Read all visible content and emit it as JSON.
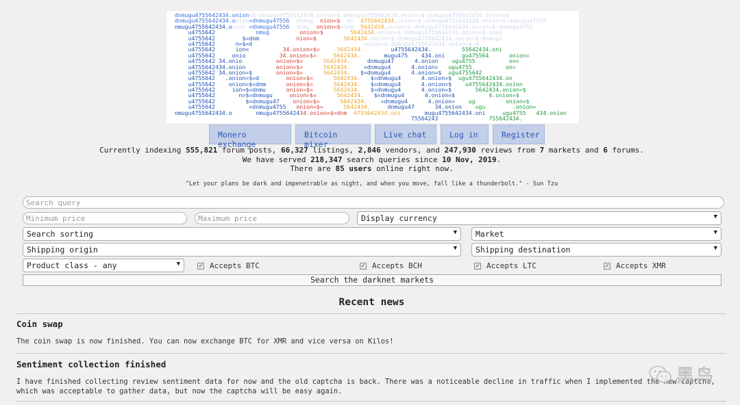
{
  "logo_rows": [
    [
      [
        "c-f",
        "  "
      ],
      [
        "c-b",
        "dnmugu4755642434.onion"
      ],
      [
        "c-f",
        "=$-dnmugu4755642434.onion=$-dnmugu4755642434.onion=$-dnmugu4755642434.onion=$"
      ]
    ],
    [
      [
        "c-b",
        "  dnmugu4755642434.o"
      ],
      [
        "c-f",
        "nion"
      ],
      [
        "c-b",
        "=dnmugu47556"
      ],
      [
        "c-f",
        "  dnmug"
      ],
      [
        "c-r",
        "  nion=$"
      ],
      [
        "c-f",
        "  dn  "
      ],
      [
        "c-o",
        "4755642434."
      ],
      [
        "c-f",
        "onion=$-dnmugu4755642434.onion=$-dnmugu47556"
      ]
    ],
    [
      [
        "c-n",
        "  nmugu4755642434.o"
      ],
      [
        "c-f",
        "nion "
      ],
      [
        "c-b",
        "=dnmugu47556"
      ],
      [
        "c-f",
        "  dnmu"
      ],
      [
        "c-r",
        "  onion=$-"
      ],
      [
        "c-f",
        "dnm  "
      ],
      [
        "c-o",
        "5642434."
      ],
      [
        "c-f",
        "onion=$-dnmugu4755642434.onion=$-dnmugu4755"
      ]
    ],
    [
      [
        "c-f",
        "      "
      ],
      [
        "c-n",
        "u4755642"
      ],
      [
        "c-f",
        "            "
      ],
      [
        "c-b",
        "nmug"
      ],
      [
        "c-f",
        "         "
      ],
      [
        "c-r",
        "onion=$"
      ],
      [
        "c-f",
        "        "
      ],
      [
        "c-o",
        "5642434."
      ],
      [
        "c-f",
        "onion=$-dnmugu4755642434.onion=$-dnmu"
      ]
    ],
    [
      [
        "c-f",
        "      "
      ],
      [
        "c-n",
        "u4755642"
      ],
      [
        "c-f",
        "        "
      ],
      [
        "c-n",
        "$=dnm"
      ],
      [
        "c-f",
        "           "
      ],
      [
        "c-r",
        "nion=$"
      ],
      [
        "c-f",
        "        "
      ],
      [
        "c-o",
        "5642434."
      ],
      [
        "c-f",
        "onion=$-dnmugu4755642434.onion=$-dnmugu"
      ]
    ],
    [
      [
        "c-f",
        "      "
      ],
      [
        "c-n",
        "u4755642"
      ],
      [
        "c-f",
        "      "
      ],
      [
        "c-n",
        "n=$=d"
      ],
      [
        "c-f",
        "                                 onion=$-dnmugu4755642434.onion=$-d"
      ]
    ],
    [
      [
        "c-f",
        "      "
      ],
      [
        "c-n",
        "u4755642"
      ],
      [
        "c-f",
        "      "
      ],
      [
        "c-n",
        "ion="
      ],
      [
        "c-f",
        "          "
      ],
      [
        "c-r",
        "34.onion=$="
      ],
      [
        "c-f",
        "     "
      ],
      [
        "c-o",
        "5642434."
      ],
      [
        "c-f",
        "        "
      ],
      [
        "c-n",
        "u4755642434."
      ],
      [
        "c-f",
        "         "
      ],
      [
        "c-g",
        "55642434.oni"
      ]
    ],
    [
      [
        "c-f",
        "      "
      ],
      [
        "c-n",
        "u4755642"
      ],
      [
        "c-f",
        "     "
      ],
      [
        "c-n",
        "onio"
      ],
      [
        "c-f",
        "          "
      ],
      [
        "c-r",
        "34.onion=$="
      ],
      [
        "c-f",
        "     "
      ],
      [
        "c-o",
        "5642434."
      ],
      [
        "c-f",
        "       "
      ],
      [
        "c-n",
        "mugu475"
      ],
      [
        "c-f",
        "    "
      ],
      [
        "c-n",
        "434.oni"
      ],
      [
        "c-f",
        "     "
      ],
      [
        "c-g",
        "gu475564"
      ],
      [
        "c-f",
        "      "
      ],
      [
        "c-g",
        "onion="
      ]
    ],
    [
      [
        "c-f",
        "      "
      ],
      [
        "c-n",
        "u4755642 34.onio"
      ],
      [
        "c-f",
        "          "
      ],
      [
        "c-r",
        "onion=$="
      ],
      [
        "c-f",
        "      "
      ],
      [
        "c-o",
        "5642434."
      ],
      [
        "c-f",
        "     "
      ],
      [
        "c-n",
        "dnmugu47"
      ],
      [
        "c-f",
        "      "
      ],
      [
        "c-n",
        "4.onion"
      ],
      [
        "c-f",
        "    "
      ],
      [
        "c-g",
        "ugu4755"
      ],
      [
        "c-f",
        "          "
      ],
      [
        "c-g",
        "on="
      ]
    ],
    [
      [
        "c-f",
        "      "
      ],
      [
        "c-n",
        "u4755642434.onion"
      ],
      [
        "c-f",
        "         "
      ],
      [
        "c-r",
        "onion=$="
      ],
      [
        "c-f",
        "      "
      ],
      [
        "c-o",
        "5642434."
      ],
      [
        "c-f",
        "    "
      ],
      [
        "c-n",
        "=dnmugu4"
      ],
      [
        "c-f",
        "      "
      ],
      [
        "c-n",
        "4.onion="
      ],
      [
        "c-f",
        "   "
      ],
      [
        "c-g",
        "ugu4755"
      ],
      [
        "c-f",
        "          "
      ],
      [
        "c-g",
        "on="
      ]
    ],
    [
      [
        "c-f",
        "      "
      ],
      [
        "c-n",
        "u4755642 34.onion=$"
      ],
      [
        "c-f",
        "       "
      ],
      [
        "c-r",
        "onion=$="
      ],
      [
        "c-f",
        "      "
      ],
      [
        "c-o",
        "5642434."
      ],
      [
        "c-f",
        "   "
      ],
      [
        "c-n",
        "$=dnmugu4"
      ],
      [
        "c-f",
        "      "
      ],
      [
        "c-n",
        "4.onion=$"
      ],
      [
        "c-f",
        "  "
      ],
      [
        "c-g",
        "ugu4755642"
      ]
    ],
    [
      [
        "c-f",
        "      "
      ],
      [
        "c-n",
        "u4755642"
      ],
      [
        "c-f",
        "   "
      ],
      [
        "c-n",
        ".onion=$=d"
      ],
      [
        "c-f",
        "        "
      ],
      [
        "c-r",
        "onion=$="
      ],
      [
        "c-f",
        "      "
      ],
      [
        "c-o",
        "5642434."
      ],
      [
        "c-f",
        "   "
      ],
      [
        "c-n",
        "$=dnmugu4"
      ],
      [
        "c-f",
        "      "
      ],
      [
        "c-n",
        "4.onion=$"
      ],
      [
        "c-f",
        "  "
      ],
      [
        "c-g",
        "ugu4755642434.on"
      ]
    ],
    [
      [
        "c-f",
        "      "
      ],
      [
        "c-n",
        "u4755642"
      ],
      [
        "c-f",
        "    "
      ],
      [
        "c-n",
        "onion=$=dnm"
      ],
      [
        "c-f",
        "      "
      ],
      [
        "c-r",
        "onion=$="
      ],
      [
        "c-f",
        "      "
      ],
      [
        "c-o",
        "5642434."
      ],
      [
        "c-f",
        "   "
      ],
      [
        "c-n",
        "$=dnmugu4"
      ],
      [
        "c-f",
        "      "
      ],
      [
        "c-n",
        "4.onion=$"
      ],
      [
        "c-f",
        "    "
      ],
      [
        "c-g",
        "u4755642434.onion"
      ]
    ],
    [
      [
        "c-f",
        "      "
      ],
      [
        "c-n",
        "u4755642"
      ],
      [
        "c-f",
        "     "
      ],
      [
        "c-n",
        "ion=$=dnmu"
      ],
      [
        "c-f",
        "      "
      ],
      [
        "c-r",
        "onion=$="
      ],
      [
        "c-f",
        "      "
      ],
      [
        "c-o",
        "5642434."
      ],
      [
        "c-f",
        "   "
      ],
      [
        "c-n",
        "$=dnmugu4"
      ],
      [
        "c-f",
        "      "
      ],
      [
        "c-n",
        "4.onion=$"
      ],
      [
        "c-f",
        "       "
      ],
      [
        "c-g",
        "5642434.onion=$"
      ]
    ],
    [
      [
        "c-f",
        "      "
      ],
      [
        "c-n",
        "u4755642"
      ],
      [
        "c-f",
        "       "
      ],
      [
        "c-n",
        "n=$=dnmugu"
      ],
      [
        "c-f",
        "     "
      ],
      [
        "c-r",
        "onion=$="
      ],
      [
        "c-f",
        "      "
      ],
      [
        "c-o",
        "5642434."
      ],
      [
        "c-f",
        "   "
      ],
      [
        "c-n",
        "$=dnmugu4"
      ],
      [
        "c-f",
        "      "
      ],
      [
        "c-n",
        "4.onion=$"
      ],
      [
        "c-f",
        "          "
      ],
      [
        "c-g",
        "4.onion=$"
      ]
    ],
    [
      [
        "c-f",
        "      "
      ],
      [
        "c-n",
        "u4755642"
      ],
      [
        "c-f",
        "         "
      ],
      [
        "c-n",
        "$=dnmugu47"
      ],
      [
        "c-f",
        "    "
      ],
      [
        "c-r",
        "onion=$="
      ],
      [
        "c-f",
        "      "
      ],
      [
        "c-o",
        "5642434."
      ],
      [
        "c-f",
        "    "
      ],
      [
        "c-n",
        "=dnmugu4"
      ],
      [
        "c-f",
        "      "
      ],
      [
        "c-n",
        "4.onion="
      ],
      [
        "c-f",
        "    "
      ],
      [
        "c-g",
        "ug"
      ],
      [
        "c-f",
        "         "
      ],
      [
        "c-g",
        "onion=$"
      ]
    ],
    [
      [
        "c-f",
        "      "
      ],
      [
        "c-n",
        "u4755642"
      ],
      [
        "c-f",
        "          "
      ],
      [
        "c-n",
        "=dnmugu4755"
      ],
      [
        "c-f",
        "   "
      ],
      [
        "c-r",
        "onion=$="
      ],
      [
        "c-f",
        "      "
      ],
      [
        "c-o",
        "5642434."
      ],
      [
        "c-f",
        "     "
      ],
      [
        "c-n",
        "dnmugu47"
      ],
      [
        "c-f",
        "      "
      ],
      [
        "c-n",
        "34.onion"
      ],
      [
        "c-f",
        "    "
      ],
      [
        "c-g",
        "ugu"
      ],
      [
        "c-f",
        "        "
      ],
      [
        "c-g",
        ".onion="
      ]
    ],
    [
      [
        "c-f",
        "  "
      ],
      [
        "c-n",
        "nmugu4755642434.o"
      ],
      [
        "c-f",
        "       "
      ],
      [
        "c-n",
        "nmugu47556424"
      ],
      [
        "c-r",
        "34.onion=$=dnm"
      ],
      [
        "c-f",
        "  "
      ],
      [
        "c-o",
        "4755642434.oni"
      ],
      [
        "c-f",
        "       "
      ],
      [
        "c-n",
        "mugu4755642434.oni"
      ],
      [
        "c-f",
        "     "
      ],
      [
        "c-g",
        "ugu4755   434.onion"
      ]
    ],
    [
      [
        "c-f",
        "                                                                        "
      ],
      [
        "c-n",
        "75564243"
      ],
      [
        "c-f",
        "               "
      ],
      [
        "c-g",
        "75564243"
      ],
      [
        "c-g",
        "4."
      ]
    ]
  ],
  "nav": {
    "monero": "Monero exchange",
    "bitcoin": "Bitcoin mixer",
    "chat": "Live chat",
    "login": "Log in",
    "register": "Register"
  },
  "stats": {
    "l1_a": "Currently indexing ",
    "posts": "555,821",
    "l1_b": " forum posts, ",
    "listings": "66,327",
    "l1_c": " listings, ",
    "vendors": "2,846",
    "l1_d": " vendors, and ",
    "reviews": "247,930",
    "l1_e": " reviews from ",
    "markets": "7",
    "l1_f": " markets and ",
    "forums": "6",
    "l1_g": " forums.",
    "l2_a": "We have served ",
    "queries": "218,347",
    "l2_b": " search queries since ",
    "since": "10 Nov, 2019",
    "l2_c": ".",
    "l3_a": "There are ",
    "users": "85 users",
    "l3_b": " online right now."
  },
  "quote": "\"Let your plans be dark and impenetrable as night, and when you move, fall like a thunderbolt.\" - Sun Tzu",
  "search": {
    "query_placeholder": "Search query",
    "min_placeholder": "Minimum price",
    "max_placeholder": "Maximum price",
    "currency": "Display currency",
    "sorting": "Search sorting",
    "market": "Market",
    "origin": "Shipping origin",
    "destination": "Shipping destination",
    "product_class": "Product class - any",
    "btc": "Accepts BTC",
    "bch": "Accepts BCH",
    "ltc": "Accepts LTC",
    "xmr": "Accepts XMR",
    "submit": "Search the darknet markets",
    "checkmark": "✓",
    "arrow": "▼"
  },
  "news": {
    "heading": "Recent news",
    "posts": [
      {
        "title": "Coin swap",
        "body": "The coin swap is now finished. You can now exchange BTC for XMR and vice versa on Kilos!"
      },
      {
        "title": "Sentiment collection finished",
        "body": "I have finished collecting review sentiment data for now and the old captcha is back. There was a noticeable decline in traffic when I implemented the new captcha, which was acceptable to gather data, but now the captcha will be easy again."
      }
    ]
  },
  "watermark": {
    "icon": "wechat-icon",
    "text": "黑鸟"
  }
}
